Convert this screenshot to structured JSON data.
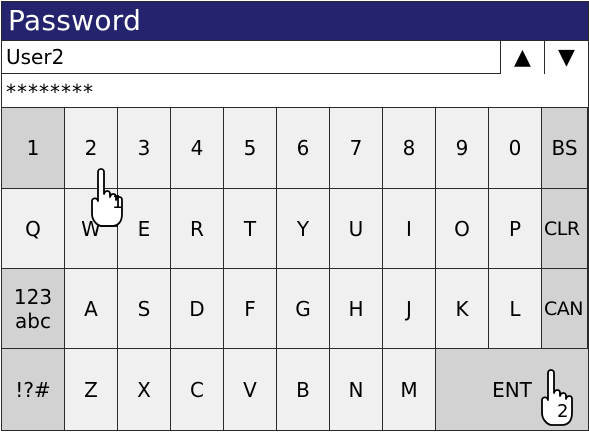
{
  "title": "Password",
  "user": {
    "value": "User2",
    "up_arrow": "▲",
    "down_arrow": "▼"
  },
  "password": {
    "value": "********"
  },
  "keys": {
    "row1": [
      "1",
      "2",
      "3",
      "4",
      "5",
      "6",
      "7",
      "8",
      "9",
      "0",
      "BS"
    ],
    "row2": [
      "Q",
      "W",
      "E",
      "R",
      "T",
      "Y",
      "U",
      "I",
      "O",
      "P",
      "CLR"
    ],
    "row3": [
      "123",
      "abc",
      "A",
      "S",
      "D",
      "F",
      "G",
      "H",
      "J",
      "K",
      "L",
      "CAN"
    ],
    "row4": [
      "!?#",
      "Z",
      "X",
      "C",
      "V",
      "B",
      "N",
      "M",
      "ENT"
    ]
  },
  "callouts": {
    "first": "1",
    "second": "2"
  },
  "colors": {
    "titlebar": "#24246e",
    "key": "#f0f0f0",
    "special_key": "#d2d2d2"
  }
}
